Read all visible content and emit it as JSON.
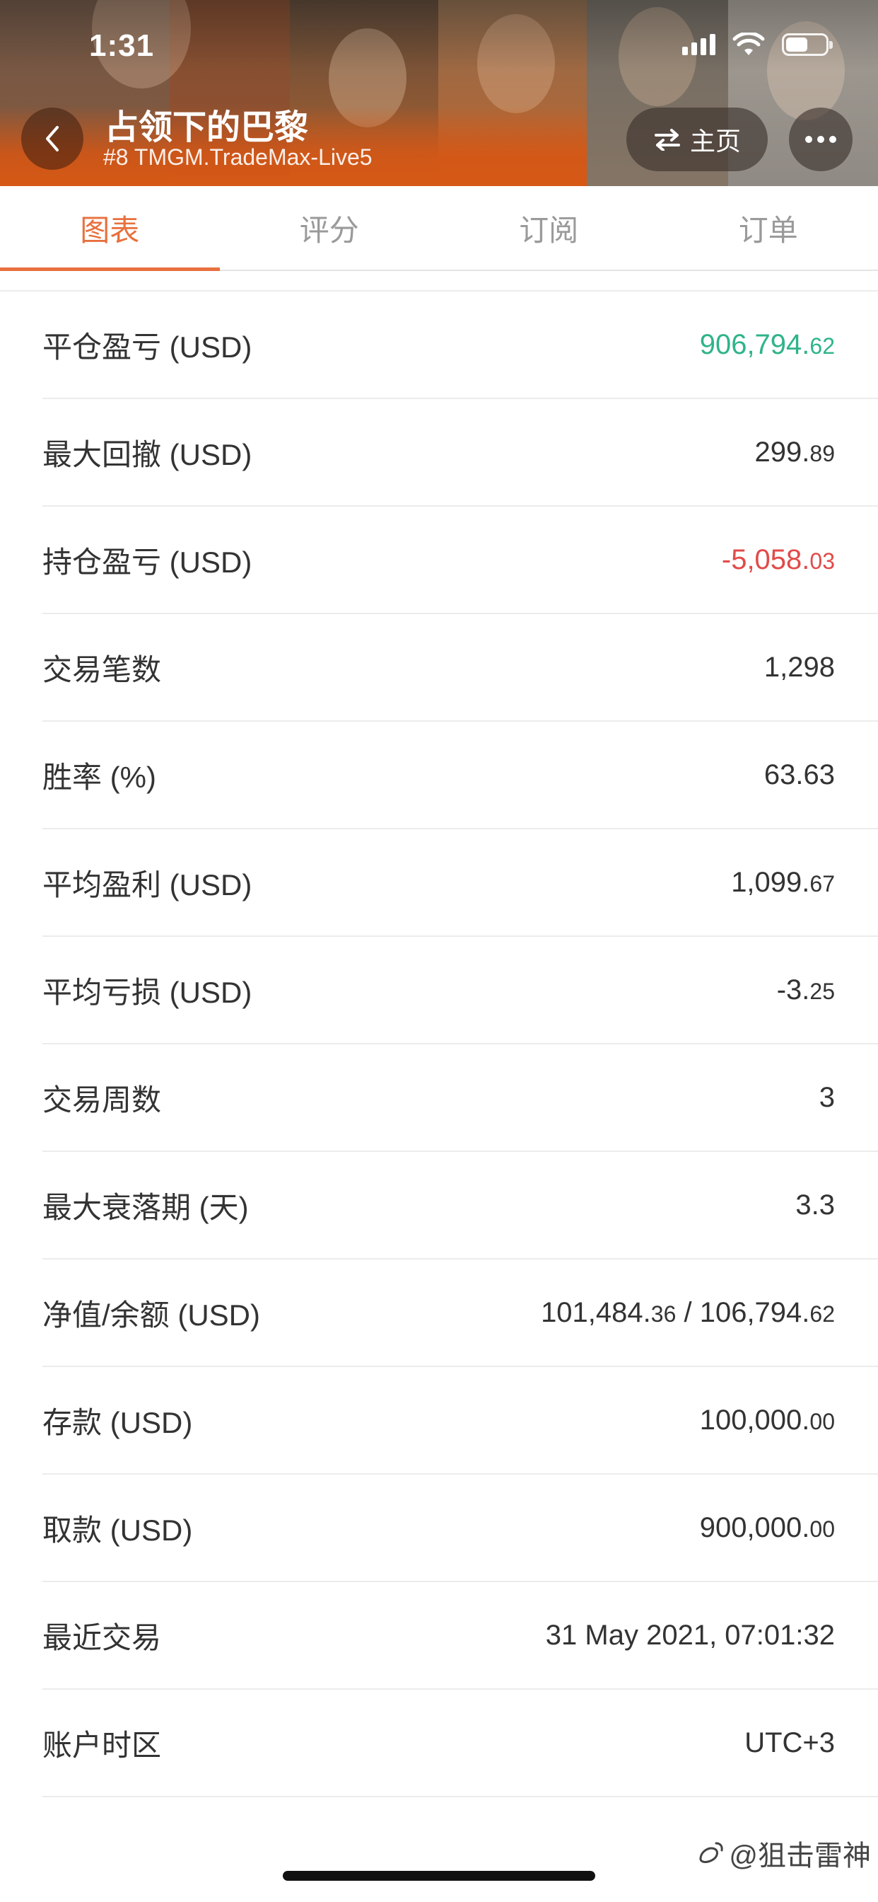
{
  "status_bar": {
    "time": "1:31"
  },
  "header": {
    "title": "占领下的巴黎",
    "subtitle": "#8 TMGM.TradeMax-Live5",
    "home_label": "主页"
  },
  "tabs": [
    {
      "label": "图表",
      "active": true
    },
    {
      "label": "评分",
      "active": false
    },
    {
      "label": "订阅",
      "active": false
    },
    {
      "label": "订单",
      "active": false
    }
  ],
  "stats": [
    {
      "label": "平仓盈亏 (USD)",
      "main": "906,794.",
      "small": "62",
      "tone": "positive"
    },
    {
      "label": "最大回撤 (USD)",
      "main": "299.",
      "small": "89",
      "tone": "normal"
    },
    {
      "label": "持仓盈亏 (USD)",
      "main": "-5,058.",
      "small": "03",
      "tone": "negative"
    },
    {
      "label": "交易笔数",
      "main": "1,298",
      "tone": "normal"
    },
    {
      "label": "胜率 (%)",
      "main": "63.63",
      "tone": "normal"
    },
    {
      "label": "平均盈利 (USD)",
      "main": "1,099.",
      "small": "67",
      "tone": "normal"
    },
    {
      "label": "平均亏损 (USD)",
      "main": "-3.",
      "small": "25",
      "tone": "normal"
    },
    {
      "label": "交易周数",
      "main": "3",
      "tone": "normal"
    },
    {
      "label": "最大衰落期 (天)",
      "main": "3.3",
      "tone": "normal"
    },
    {
      "label": "净值/余额 (USD)",
      "main": "101,484.",
      "small": "36",
      "main2": " / 106,794.",
      "small2": "62",
      "tone": "normal"
    },
    {
      "label": "存款 (USD)",
      "main": "100,000.",
      "small": "00",
      "tone": "normal"
    },
    {
      "label": "取款 (USD)",
      "main": "900,000.",
      "small": "00",
      "tone": "normal"
    },
    {
      "label": "最近交易",
      "main": "31 May 2021, 07:01:32",
      "tone": "normal"
    },
    {
      "label": "账户时区",
      "main": "UTC+3",
      "tone": "normal"
    }
  ],
  "watermark": "@狙击雷神",
  "colors": {
    "accent": "#e8703e",
    "positive": "#2fb38a",
    "negative": "#e24a4a",
    "header_orange": "#d65815"
  }
}
